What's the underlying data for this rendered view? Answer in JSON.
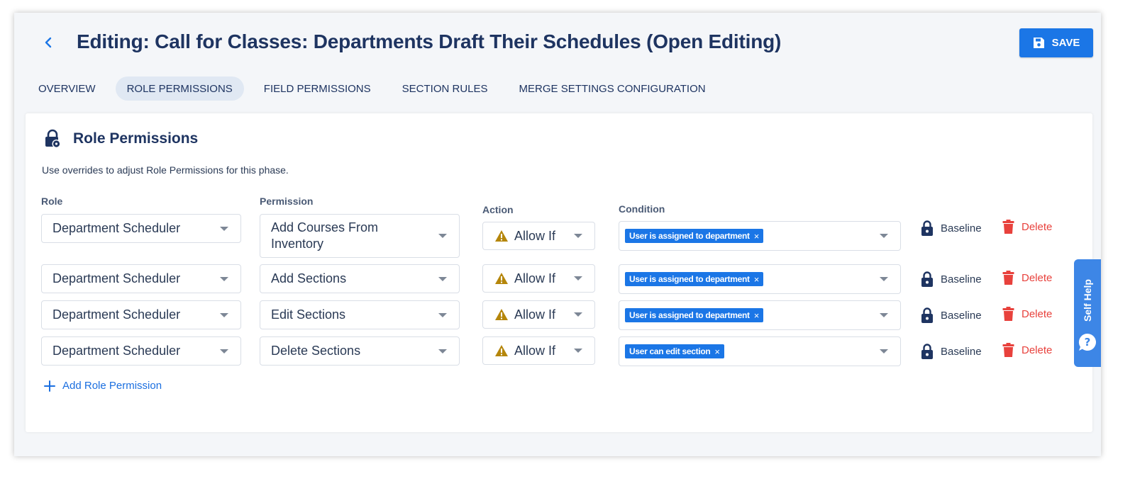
{
  "header": {
    "title": "Editing: Call for Classes: Departments Draft Their Schedules (Open Editing)",
    "save_label": "SAVE"
  },
  "tabs": [
    {
      "label": "OVERVIEW",
      "active": false
    },
    {
      "label": "ROLE PERMISSIONS",
      "active": true
    },
    {
      "label": "FIELD PERMISSIONS",
      "active": false
    },
    {
      "label": "SECTION RULES",
      "active": false
    },
    {
      "label": "MERGE SETTINGS CONFIGURATION",
      "active": false
    }
  ],
  "card": {
    "title": "Role Permissions",
    "description": "Use overrides to adjust Role Permissions for this phase.",
    "columns": {
      "role": "Role",
      "permission": "Permission",
      "action": "Action",
      "condition": "Condition"
    },
    "rows": [
      {
        "role": "Department Scheduler",
        "permission": "Add Courses From Inventory",
        "action": "Allow If",
        "condition": "User is assigned to department",
        "baseline": "Baseline",
        "delete": "Delete"
      },
      {
        "role": "Department Scheduler",
        "permission": "Add Sections",
        "action": "Allow If",
        "condition": "User is assigned to department",
        "baseline": "Baseline",
        "delete": "Delete"
      },
      {
        "role": "Department Scheduler",
        "permission": "Edit Sections",
        "action": "Allow If",
        "condition": "User is assigned to department",
        "baseline": "Baseline",
        "delete": "Delete"
      },
      {
        "role": "Department Scheduler",
        "permission": "Delete Sections",
        "action": "Allow If",
        "condition": "User can edit section",
        "baseline": "Baseline",
        "delete": "Delete"
      }
    ],
    "add_label": "Add Role Permission"
  },
  "self_help": {
    "label": "Self Help"
  },
  "colors": {
    "primary": "#1b76e6",
    "title": "#1e3461",
    "delete": "#e8413c",
    "warning": "#b5860b",
    "active_tab_bg": "#e0e8f3"
  }
}
